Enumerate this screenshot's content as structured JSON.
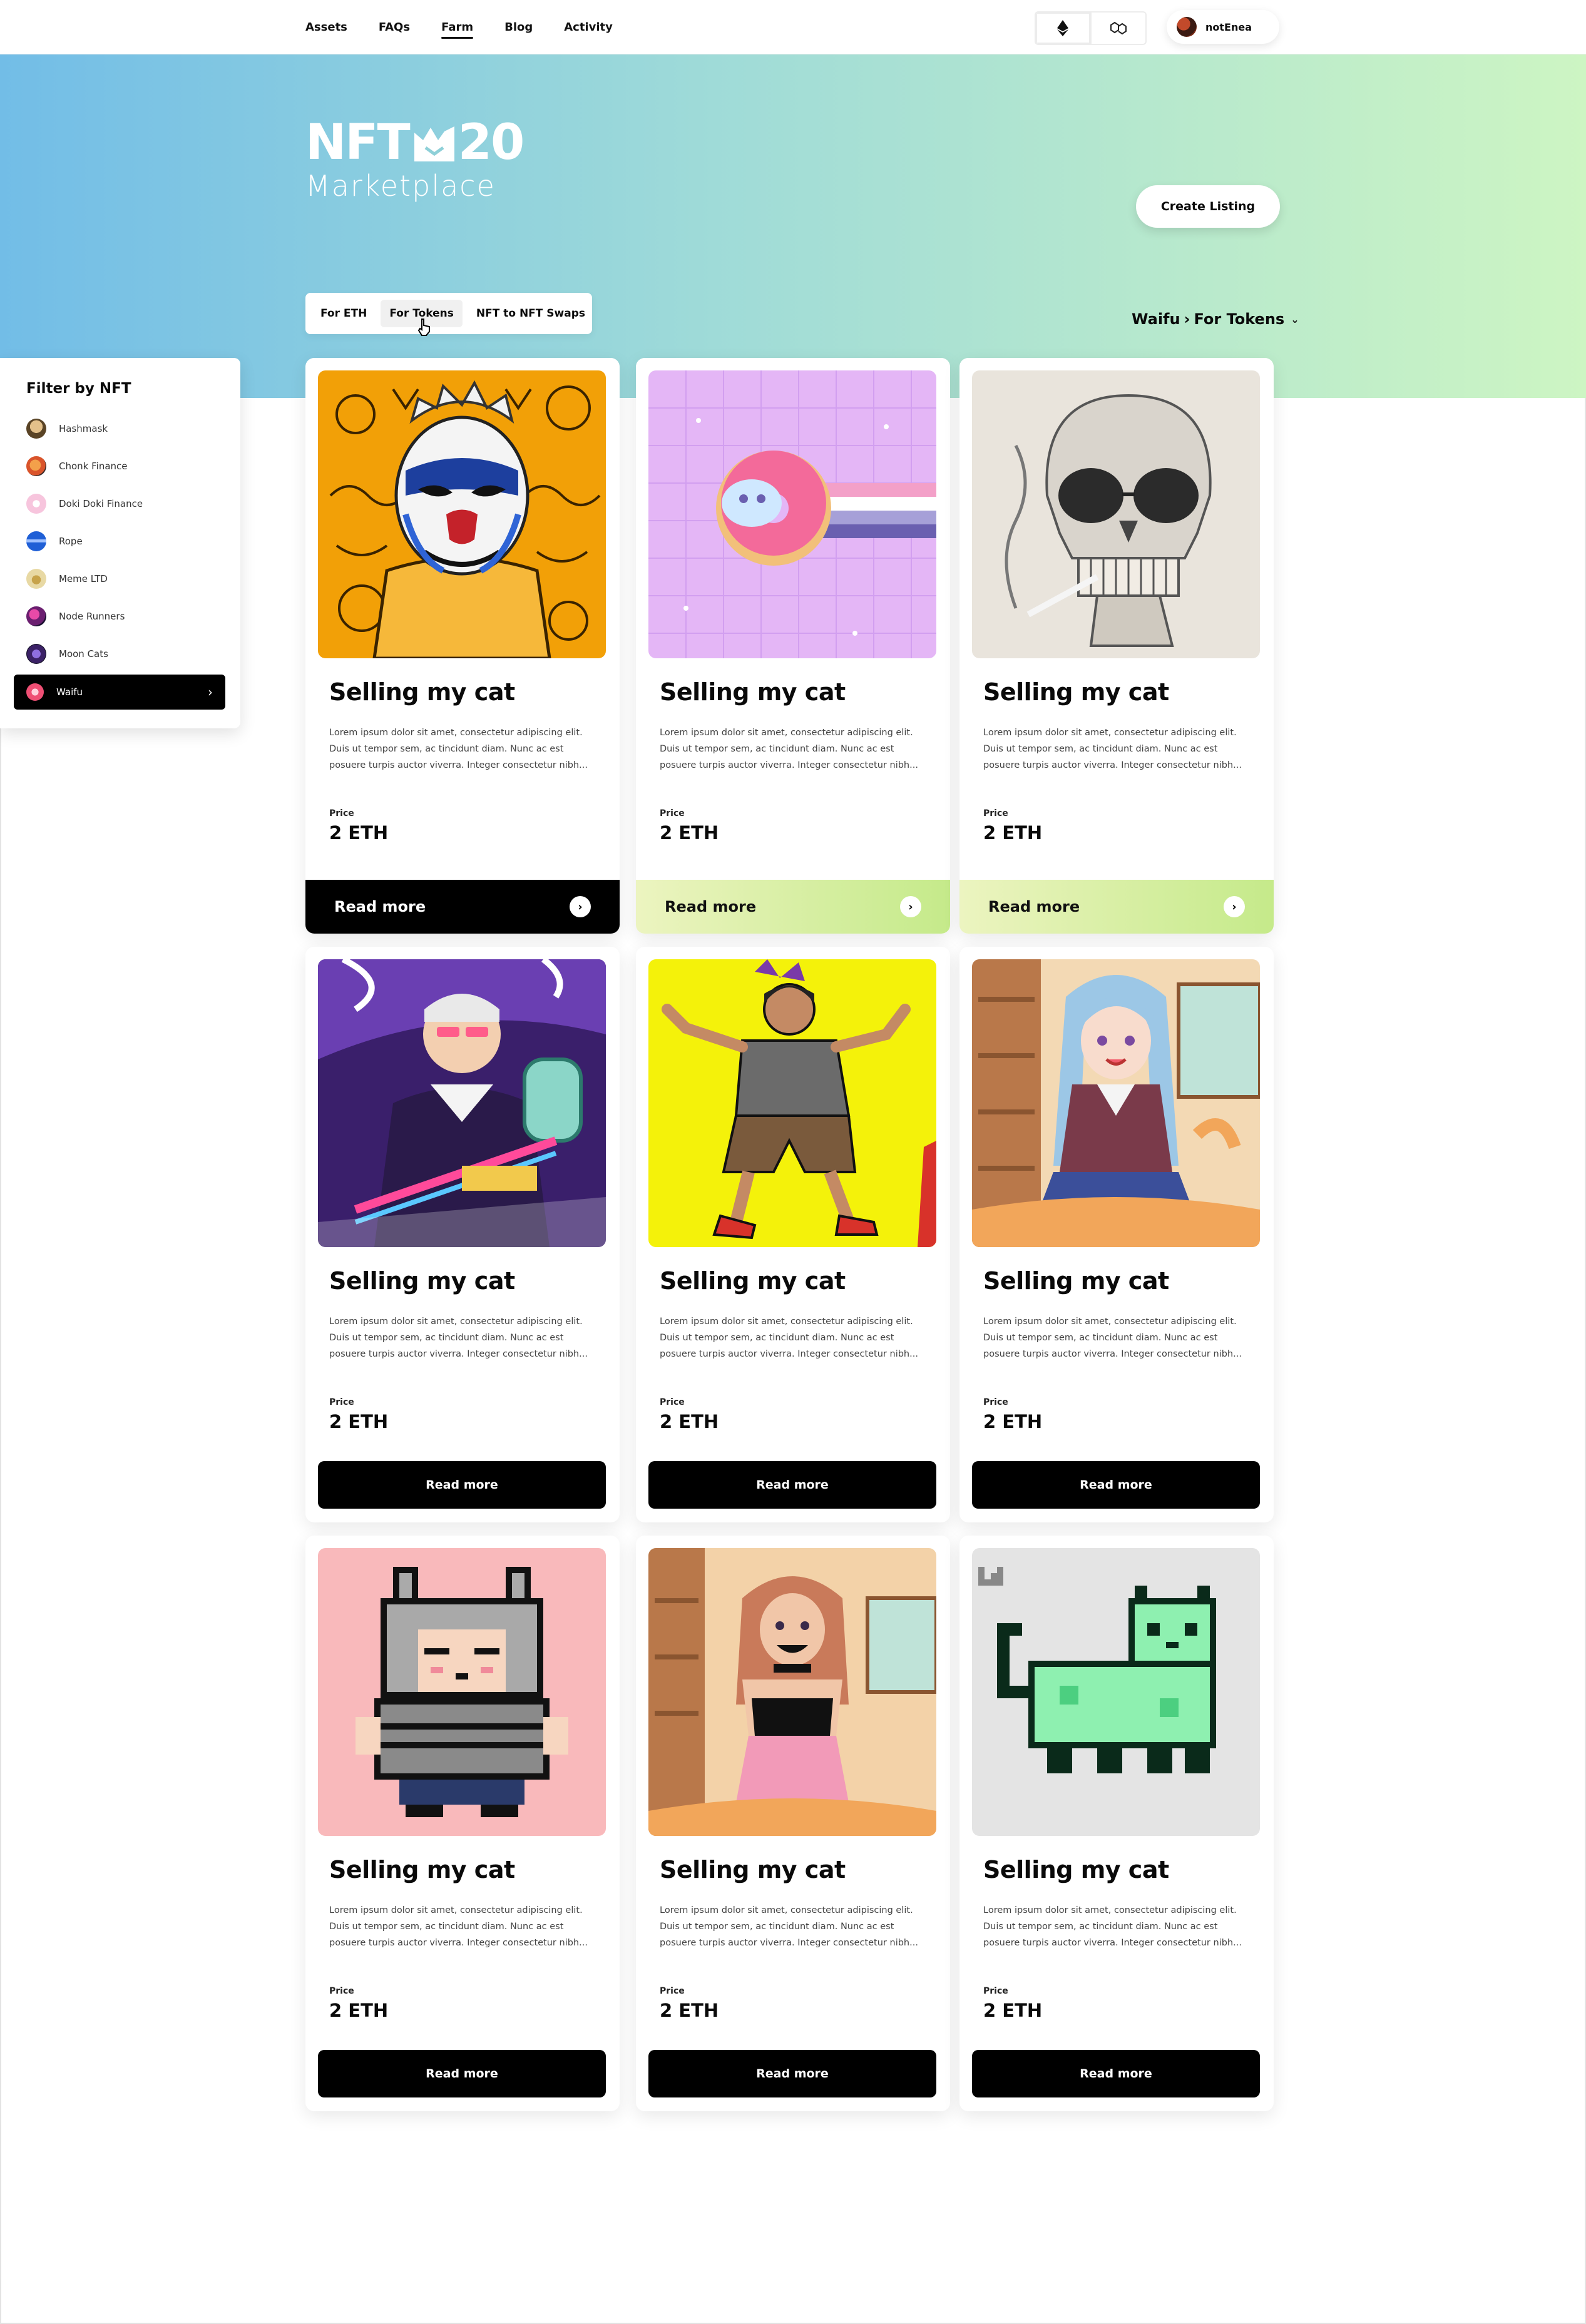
{
  "nav": {
    "links": [
      "Assets",
      "FAQs",
      "Farm",
      "Blog",
      "Activity"
    ],
    "active": "Farm",
    "account_name": "notEnea"
  },
  "hero": {
    "logo_top": "NFT20",
    "logo_sub": "Marketplace",
    "create_listing": "Create Listing",
    "tabs": [
      "For ETH",
      "For Tokens",
      "NFT to NFT Swaps"
    ],
    "active_tab": "For Tokens",
    "breadcrumb_collection": "Waifu",
    "breadcrumb_sep": "›",
    "breadcrumb_page": "For Tokens"
  },
  "sidebar": {
    "title": "Filter by NFT",
    "items": [
      {
        "label": "Hashmask",
        "color": "#8a6a3c"
      },
      {
        "label": "Chonk Finance",
        "color": "#d9542b"
      },
      {
        "label": "Doki Doki Finance",
        "color": "#f7c5dd"
      },
      {
        "label": "Rope",
        "color": "#1f5fd6"
      },
      {
        "label": "Meme LTD",
        "color": "#e8d9a4"
      },
      {
        "label": "Node Runners",
        "color": "#6b1f70"
      },
      {
        "label": "Moon Cats",
        "color": "#3b2166"
      },
      {
        "label": "Waifu",
        "color": "#ef4f74"
      }
    ],
    "selected": "Waifu"
  },
  "cards": [
    {
      "title": "Selling my cat",
      "desc": "Lorem ipsum dolor sit amet, consectetur adipiscing elit. Duis ut tempor sem, ac tincidunt diam. Nunc ac est posuere turpis auctor viverra. Integer consectetur nibh...",
      "price_label": "Price",
      "price": "2 ETH",
      "cta": "Read more"
    },
    {
      "title": "Selling my cat",
      "desc": "Lorem ipsum dolor sit amet, consectetur adipiscing elit. Duis ut tempor sem, ac tincidunt diam. Nunc ac est posuere turpis auctor viverra. Integer consectetur nibh...",
      "price_label": "Price",
      "price": "2 ETH",
      "cta": "Read more"
    },
    {
      "title": "Selling my cat",
      "desc": "Lorem ipsum dolor sit amet, consectetur adipiscing elit. Duis ut tempor sem, ac tincidunt diam. Nunc ac est posuere turpis auctor viverra. Integer consectetur nibh...",
      "price_label": "Price",
      "price": "2 ETH",
      "cta": "Read more"
    },
    {
      "title": "Selling my cat",
      "desc": "Lorem ipsum dolor sit amet, consectetur adipiscing elit. Duis ut tempor sem, ac tincidunt diam. Nunc ac est posuere turpis auctor viverra. Integer consectetur nibh...",
      "price_label": "Price",
      "price": "2 ETH",
      "cta": "Read more"
    },
    {
      "title": "Selling my cat",
      "desc": "Lorem ipsum dolor sit amet, consectetur adipiscing elit. Duis ut tempor sem, ac tincidunt diam. Nunc ac est posuere turpis auctor viverra. Integer consectetur nibh...",
      "price_label": "Price",
      "price": "2 ETH",
      "cta": "Read more"
    },
    {
      "title": "Selling my cat",
      "desc": "Lorem ipsum dolor sit amet, consectetur adipiscing elit. Duis ut tempor sem, ac tincidunt diam. Nunc ac est posuere turpis auctor viverra. Integer consectetur nibh...",
      "price_label": "Price",
      "price": "2 ETH",
      "cta": "Read more"
    },
    {
      "title": "Selling my cat",
      "desc": "Lorem ipsum dolor sit amet, consectetur adipiscing elit. Duis ut tempor sem, ac tincidunt diam. Nunc ac est posuere turpis auctor viverra. Integer consectetur nibh...",
      "price_label": "Price",
      "price": "2 ETH",
      "cta": "Read more"
    },
    {
      "title": "Selling my cat",
      "desc": "Lorem ipsum dolor sit amet, consectetur adipiscing elit. Duis ut tempor sem, ac tincidunt diam. Nunc ac est posuere turpis auctor viverra. Integer consectetur nibh...",
      "price_label": "Price",
      "price": "2 ETH",
      "cta": "Read more"
    },
    {
      "title": "Selling my cat",
      "desc": "Lorem ipsum dolor sit amet, consectetur adipiscing elit. Duis ut tempor sem, ac tincidunt diam. Nunc ac est posuere turpis auctor viverra. Integer consectetur nibh...",
      "price_label": "Price",
      "price": "2 ETH",
      "cta": "Read more"
    }
  ],
  "colors": {
    "hero_start": "#72bde7",
    "hero_end": "#cdf5c3",
    "button_dark": "#000000",
    "button_green": "#c5ea8a"
  }
}
